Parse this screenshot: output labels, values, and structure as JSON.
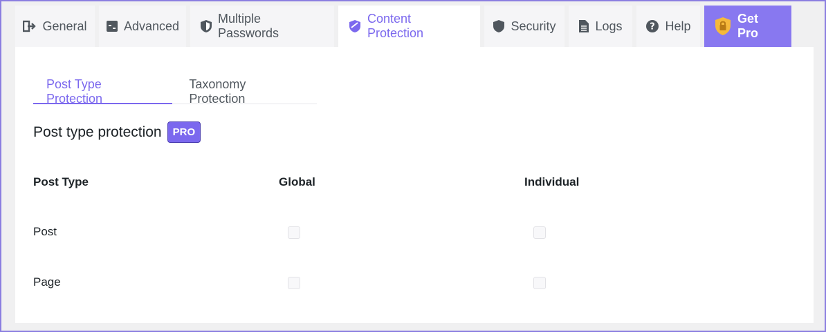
{
  "tabs": [
    {
      "label": "General",
      "icon": "exit-icon"
    },
    {
      "label": "Advanced",
      "icon": "advanced-icon"
    },
    {
      "label": "Multiple Passwords",
      "icon": "shield-icon"
    },
    {
      "label": "Content Protection",
      "icon": "shield-check-icon"
    },
    {
      "label": "Security",
      "icon": "shield-icon"
    },
    {
      "label": "Logs",
      "icon": "document-icon"
    },
    {
      "label": "Help",
      "icon": "help-icon"
    },
    {
      "label": "Get Pro",
      "icon": "lock-shield-icon"
    }
  ],
  "active_tab": "Content Protection",
  "subtabs": [
    {
      "label": "Post Type Protection"
    },
    {
      "label": "Taxonomy Protection"
    }
  ],
  "section": {
    "title": "Post type protection",
    "badge": "PRO"
  },
  "table": {
    "headers": [
      "Post Type",
      "Global",
      "Individual"
    ],
    "rows": [
      {
        "type": "Post",
        "global": false,
        "individual": false
      },
      {
        "type": "Page",
        "global": false,
        "individual": false
      }
    ]
  },
  "colors": {
    "accent": "#7b68ee",
    "pro_tab": "#8878f0",
    "lock_icon": "#f5b93b"
  }
}
